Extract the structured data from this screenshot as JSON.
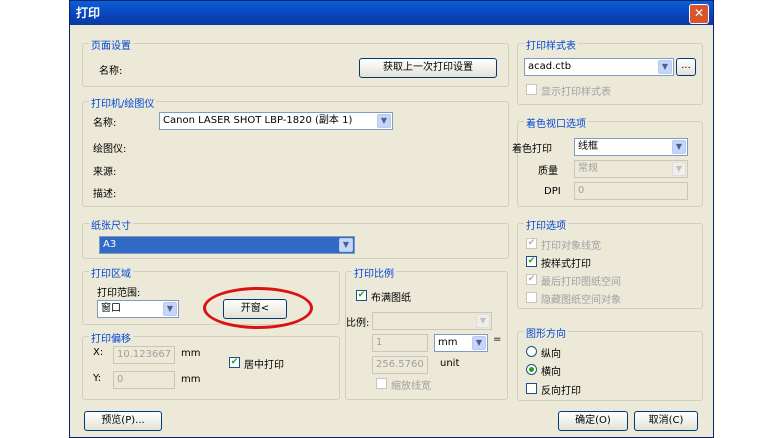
{
  "window": {
    "title": "打印",
    "close": "✕"
  },
  "page_setup": {
    "group": "页面设置",
    "name_label": "名称:",
    "get_last_button": "获取上一次打印设置"
  },
  "printer": {
    "group": "打印机/绘图仪",
    "name_label": "名称:",
    "name_value": "Canon LASER SHOT LBP-1820 (副本 1)",
    "plotter_label": "绘图仪:",
    "where_label": "来源:",
    "desc_label": "描述:"
  },
  "paper": {
    "group": "纸张尺寸",
    "value": "A3"
  },
  "area": {
    "group": "打印区域",
    "range_label": "打印范围:",
    "range_value": "窗口",
    "window_button": "开窗<"
  },
  "offset": {
    "group": "打印偏移",
    "x_label": "X:",
    "x_value": "10.123667",
    "x_unit": "mm",
    "y_label": "Y:",
    "y_value": "0",
    "y_unit": "mm",
    "center_label": "居中打印"
  },
  "scale": {
    "group": "打印比例",
    "fit_label": "布满图纸",
    "ratio_label": "比例:",
    "v1": "1",
    "unit1": "mm",
    "eq": "=",
    "v2": "256.5760",
    "unit2": "unit",
    "lineweight_label": "缩放线宽"
  },
  "style_table": {
    "group": "打印样式表",
    "value": "acad.ctb",
    "ellipsis": "...",
    "show_label": "显示打印样式表"
  },
  "shaded": {
    "group": "着色视口选项",
    "shade_label": "着色打印",
    "shade_value": "线框",
    "quality_label": "质量",
    "quality_value": "常规",
    "dpi_label": "DPI",
    "dpi_value": "0"
  },
  "options": {
    "group": "打印选项",
    "o1": "打印对象线宽",
    "o2": "按样式打印",
    "o3": "最后打印图纸空间",
    "o4": "隐藏图纸空间对象"
  },
  "orient": {
    "group": "图形方向",
    "portrait": "纵向",
    "landscape": "横向",
    "reverse": "反向打印"
  },
  "footer": {
    "preview": "预览(P)...",
    "ok": "确定(O)",
    "cancel": "取消(C)"
  }
}
